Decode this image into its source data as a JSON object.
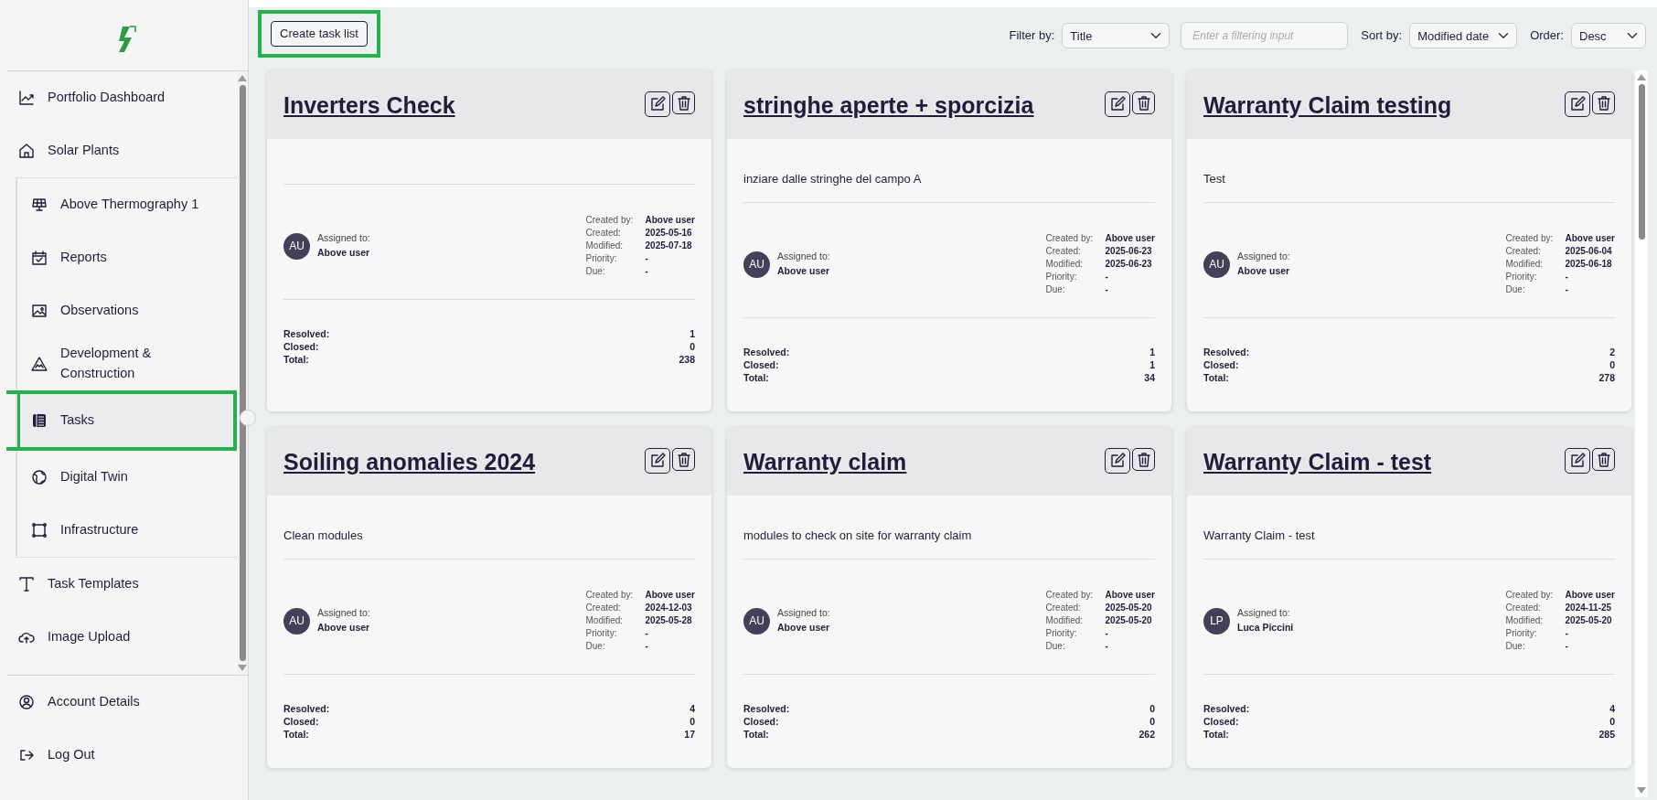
{
  "sidebar": {
    "items": [
      {
        "label": "Portfolio Dashboard",
        "selected": false,
        "highlighted": false
      },
      {
        "label": "Solar Plants",
        "selected": false,
        "highlighted": false,
        "children": [
          {
            "label": "Above Thermography 1",
            "selected": false,
            "highlighted": false
          },
          {
            "label": "Reports",
            "selected": false,
            "highlighted": false
          },
          {
            "label": "Observations",
            "selected": false,
            "highlighted": false
          },
          {
            "label": "Development & Construction",
            "selected": false,
            "highlighted": false
          },
          {
            "label": "Tasks",
            "selected": true,
            "highlighted": true
          },
          {
            "label": "Digital Twin",
            "selected": false,
            "highlighted": false
          },
          {
            "label": "Infrastructure",
            "selected": false,
            "highlighted": false
          }
        ]
      },
      {
        "label": "Task Templates",
        "selected": false,
        "highlighted": false
      },
      {
        "label": "Image Upload",
        "selected": false,
        "highlighted": false
      }
    ],
    "footer_items": [
      {
        "label": "Account Details",
        "selected": false
      },
      {
        "label": "Log Out",
        "selected": false
      }
    ]
  },
  "toolbar": {
    "create_button": {
      "label": "Create task list",
      "highlighted": true
    },
    "filter": {
      "label": "Filter by:",
      "value": "Title"
    },
    "filter_input": {
      "placeholder": "Enter a filtering input"
    },
    "sort": {
      "label": "Sort by:",
      "value": "Modified date"
    },
    "order": {
      "label": "Order:",
      "value": "Desc"
    }
  },
  "cards": [
    {
      "title": "Inverters Check",
      "assignee": {
        "label": "Assigned to:",
        "initials": "AU",
        "name": "Above user"
      },
      "meta": [
        {
          "label": "Created by:",
          "value": "Above user"
        },
        {
          "label": "Created:",
          "value": "2025-05-16"
        },
        {
          "label": "Modified:",
          "value": "2025-07-18"
        },
        {
          "label": "Priority:",
          "value": "-"
        },
        {
          "label": "Due:",
          "value": "-"
        }
      ],
      "stats": [
        {
          "label": "Resolved:",
          "value": "1"
        },
        {
          "label": "Closed:",
          "value": "0"
        },
        {
          "label": "Total:",
          "value": "238"
        }
      ]
    },
    {
      "title": "stringhe aperte + sporcizia",
      "description": "inziare dalle stringhe del campo A",
      "assignee": {
        "label": "Assigned to:",
        "initials": "AU",
        "name": "Above user"
      },
      "meta": [
        {
          "label": "Created by:",
          "value": "Above user"
        },
        {
          "label": "Created:",
          "value": "2025-06-23"
        },
        {
          "label": "Modified:",
          "value": "2025-06-23"
        },
        {
          "label": "Priority:",
          "value": "-"
        },
        {
          "label": "Due:",
          "value": "-"
        }
      ],
      "stats": [
        {
          "label": "Resolved:",
          "value": "1"
        },
        {
          "label": "Closed:",
          "value": "1"
        },
        {
          "label": "Total:",
          "value": "34"
        }
      ]
    },
    {
      "title": "Warranty Claim testing",
      "description": "Test",
      "assignee": {
        "label": "Assigned to:",
        "initials": "AU",
        "name": "Above user"
      },
      "meta": [
        {
          "label": "Created by:",
          "value": "Above user"
        },
        {
          "label": "Created:",
          "value": "2025-06-04"
        },
        {
          "label": "Modified:",
          "value": "2025-06-18"
        },
        {
          "label": "Priority:",
          "value": "-"
        },
        {
          "label": "Due:",
          "value": "-"
        }
      ],
      "stats": [
        {
          "label": "Resolved:",
          "value": "2"
        },
        {
          "label": "Closed:",
          "value": "0"
        },
        {
          "label": "Total:",
          "value": "278"
        }
      ]
    },
    {
      "title": "Soiling anomalies 2024",
      "description": "Clean modules",
      "assignee": {
        "label": "Assigned to:",
        "initials": "AU",
        "name": "Above user"
      },
      "meta": [
        {
          "label": "Created by:",
          "value": "Above user"
        },
        {
          "label": "Created:",
          "value": "2024-12-03"
        },
        {
          "label": "Modified:",
          "value": "2025-05-28"
        },
        {
          "label": "Priority:",
          "value": "-"
        },
        {
          "label": "Due:",
          "value": "-"
        }
      ],
      "stats": [
        {
          "label": "Resolved:",
          "value": "4"
        },
        {
          "label": "Closed:",
          "value": "0"
        },
        {
          "label": "Total:",
          "value": "17"
        }
      ]
    },
    {
      "title": "Warranty claim",
      "description": "modules to check on site for warranty claim",
      "assignee": {
        "label": "Assigned to:",
        "initials": "AU",
        "name": "Above user"
      },
      "meta": [
        {
          "label": "Created by:",
          "value": "Above user"
        },
        {
          "label": "Created:",
          "value": "2025-05-20"
        },
        {
          "label": "Modified:",
          "value": "2025-05-20"
        },
        {
          "label": "Priority:",
          "value": "-"
        },
        {
          "label": "Due:",
          "value": "-"
        }
      ],
      "stats": [
        {
          "label": "Resolved:",
          "value": "0"
        },
        {
          "label": "Closed:",
          "value": "0"
        },
        {
          "label": "Total:",
          "value": "262"
        }
      ]
    },
    {
      "title": "Warranty Claim - test",
      "description": "Warranty Claim - test",
      "assignee": {
        "label": "Assigned to:",
        "initials": "LP",
        "name": "Luca Piccini"
      },
      "meta": [
        {
          "label": "Created by:",
          "value": "Above user"
        },
        {
          "label": "Created:",
          "value": "2024-11-25"
        },
        {
          "label": "Modified:",
          "value": "2025-05-20"
        },
        {
          "label": "Priority:",
          "value": "-"
        },
        {
          "label": "Due:",
          "value": "-"
        }
      ],
      "stats": [
        {
          "label": "Resolved:",
          "value": "4"
        },
        {
          "label": "Closed:",
          "value": "0"
        },
        {
          "label": "Total:",
          "value": "285"
        }
      ]
    }
  ]
}
